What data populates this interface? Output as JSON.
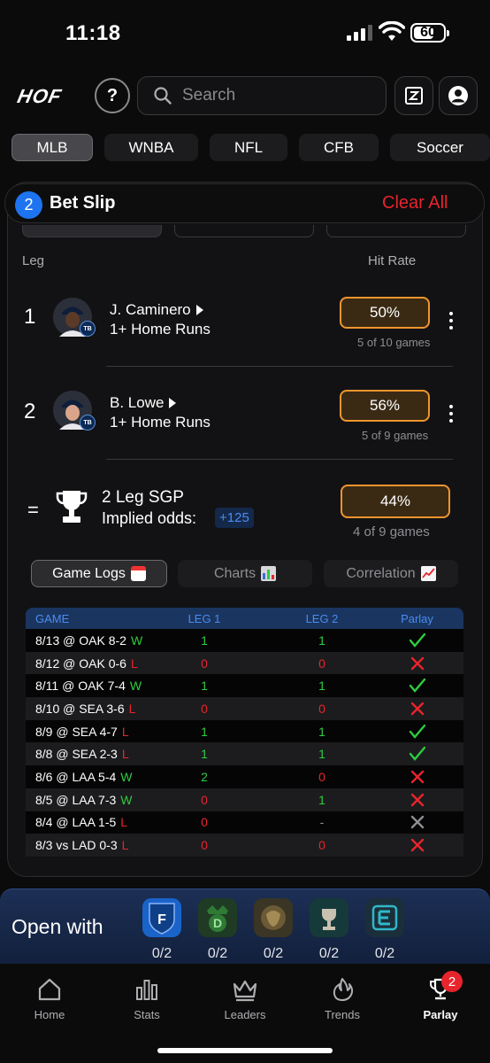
{
  "status_bar": {
    "time": "11:18",
    "battery": "60",
    "battery_level": 0.6
  },
  "header": {
    "logo": "HOF",
    "search_placeholder": "Search"
  },
  "sport_tabs": [
    "MLB",
    "WNBA",
    "NFL",
    "CFB",
    "Soccer"
  ],
  "active_sport": "MLB",
  "bet_slip": {
    "count": "2",
    "title": "Bet Slip",
    "clear_label": "Clear All",
    "col_leg": "Leg",
    "col_hit_rate": "Hit Rate",
    "legs": [
      {
        "num": "1",
        "player": "J. Caminero",
        "prop": "1+ Home Runs",
        "team": "TB",
        "hit_rate": "50%",
        "sub": "5 of 10 games"
      },
      {
        "num": "2",
        "player": "B. Lowe",
        "prop": "1+ Home Runs",
        "team": "TB",
        "hit_rate": "56%",
        "sub": "5 of 9 games"
      }
    ],
    "summary": {
      "eq": "=",
      "title": "2 Leg SGP",
      "odds_label": "Implied odds:",
      "odds": "+125",
      "hit_rate": "44%",
      "sub": "4 of 9 games"
    }
  },
  "sub_tabs": {
    "game_logs": "Game Logs",
    "charts": "Charts",
    "correlation": "Correlation"
  },
  "game_log": {
    "headers": {
      "game": "GAME",
      "leg1": "LEG 1",
      "leg2": "LEG 2",
      "parlay": "Parlay"
    },
    "rows": [
      {
        "game": "8/13 @ OAK 8-2",
        "res": "W",
        "leg1": "1",
        "leg2": "1",
        "parlay": "check"
      },
      {
        "game": "8/12 @ OAK 0-6",
        "res": "L",
        "leg1": "0",
        "leg2": "0",
        "parlay": "x"
      },
      {
        "game": "8/11 @ OAK 7-4",
        "res": "W",
        "leg1": "1",
        "leg2": "1",
        "parlay": "check"
      },
      {
        "game": "8/10 @ SEA 3-6",
        "res": "L",
        "leg1": "0",
        "leg2": "0",
        "parlay": "x"
      },
      {
        "game": "8/9 @ SEA 4-7",
        "res": "L",
        "leg1": "1",
        "leg2": "1",
        "parlay": "check"
      },
      {
        "game": "8/8 @ SEA 2-3",
        "res": "L",
        "leg1": "1",
        "leg2": "1",
        "parlay": "check"
      },
      {
        "game": "8/6 @ LAA 5-4",
        "res": "W",
        "leg1": "2",
        "leg2": "0",
        "parlay": "x"
      },
      {
        "game": "8/5 @ LAA 7-3",
        "res": "W",
        "leg1": "0",
        "leg2": "1",
        "parlay": "x"
      },
      {
        "game": "8/4 @ LAA 1-5",
        "res": "L",
        "leg1": "0",
        "leg2": "-",
        "parlay": "x-gray"
      },
      {
        "game": "8/3 vs LAD 0-3",
        "res": "L",
        "leg1": "0",
        "leg2": "0",
        "parlay": "x"
      }
    ]
  },
  "open_with": {
    "label": "Open with",
    "books": [
      {
        "icon": "fanduel-icon",
        "count": "0/2",
        "color": "#1a63c9"
      },
      {
        "icon": "draftkings-icon",
        "count": "0/2",
        "color": "#1f3b24"
      },
      {
        "icon": "betmgm-icon",
        "count": "0/2",
        "color": "#3a3524"
      },
      {
        "icon": "caesars-icon",
        "count": "0/2",
        "color": "#163a3a"
      },
      {
        "icon": "espnbet-icon",
        "count": "0/2",
        "color": "#1b2f3a"
      }
    ]
  },
  "nav": {
    "items": [
      "Home",
      "Stats",
      "Leaders",
      "Trends",
      "Parlay"
    ],
    "active": "Parlay",
    "parlay_badge": "2"
  }
}
